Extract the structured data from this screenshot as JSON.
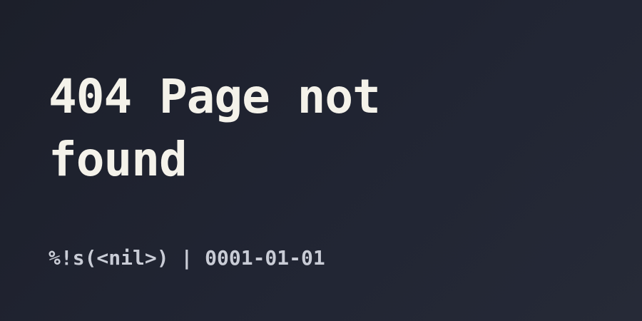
{
  "page": {
    "title": "404 Page not found",
    "meta": "%!s(<nil>) | 0001-01-01"
  },
  "colors": {
    "background": "#1f2230",
    "title": "#f4f2ea",
    "meta": "#c9ccd6"
  }
}
